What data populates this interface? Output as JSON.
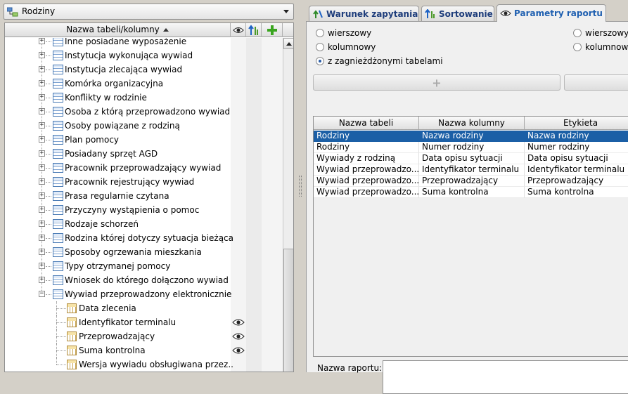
{
  "combo": {
    "value": "Rodziny"
  },
  "tree": {
    "header": {
      "name": "Nazwa tabeli/kolumny"
    },
    "items": [
      {
        "label": "Inne posiadane wyposażenie",
        "type": "table",
        "expanded": false,
        "visible": false
      },
      {
        "label": "Instytucja wykonująca wywiad",
        "type": "table",
        "expanded": false,
        "visible": false
      },
      {
        "label": "Instytucja zlecająca wywiad",
        "type": "table",
        "expanded": false,
        "visible": false
      },
      {
        "label": "Komórka organizacyjna",
        "type": "table",
        "expanded": false,
        "visible": false
      },
      {
        "label": "Konflikty w rodzinie",
        "type": "table",
        "expanded": false,
        "visible": false
      },
      {
        "label": "Osoba z którą przeprowadzono wywiad",
        "type": "table",
        "expanded": false,
        "visible": false
      },
      {
        "label": "Osoby powiązane z rodziną",
        "type": "table",
        "expanded": false,
        "visible": false
      },
      {
        "label": "Plan pomocy",
        "type": "table",
        "expanded": false,
        "visible": false
      },
      {
        "label": "Posiadany sprzęt AGD",
        "type": "table",
        "expanded": false,
        "visible": false
      },
      {
        "label": "Pracownik przeprowadzający wywiad",
        "type": "table",
        "expanded": false,
        "visible": false
      },
      {
        "label": "Pracownik rejestrujący wywiad",
        "type": "table",
        "expanded": false,
        "visible": false
      },
      {
        "label": "Prasa regularnie czytana",
        "type": "table",
        "expanded": false,
        "visible": false
      },
      {
        "label": "Przyczyny wystąpienia o pomoc",
        "type": "table",
        "expanded": false,
        "visible": false
      },
      {
        "label": "Rodzaje schorzeń",
        "type": "table",
        "expanded": false,
        "visible": false
      },
      {
        "label": "Rodzina której dotyczy sytuacja bieżąca",
        "type": "table",
        "expanded": false,
        "visible": false
      },
      {
        "label": "Sposoby ogrzewania mieszkania",
        "type": "table",
        "expanded": false,
        "visible": false
      },
      {
        "label": "Typy otrzymanej pomocy",
        "type": "table",
        "expanded": false,
        "visible": false
      },
      {
        "label": "Wniosek do którego dołączono wywiad",
        "type": "table",
        "expanded": false,
        "visible": false
      },
      {
        "label": "Wywiad przeprowadzony elektronicznie",
        "type": "table",
        "expanded": true,
        "visible": false
      },
      {
        "label": "Data zlecenia",
        "type": "field",
        "visible": false
      },
      {
        "label": "Identyfikator terminalu",
        "type": "field",
        "visible": true
      },
      {
        "label": "Przeprowadzający",
        "type": "field",
        "visible": true
      },
      {
        "label": "Suma kontrolna",
        "type": "field",
        "visible": true
      },
      {
        "label": "Wersja wywiadu obsługiwana przez..",
        "type": "field",
        "visible": false
      }
    ]
  },
  "tabs": [
    {
      "label": "Warunek zapytania",
      "icon": "filter-icon",
      "active": false
    },
    {
      "label": "Sortowanie",
      "icon": "sort-icon",
      "active": false
    },
    {
      "label": "Parametry raportu",
      "icon": "eye-icon",
      "active": true
    }
  ],
  "layout_options": {
    "left": [
      {
        "label": "wierszowy",
        "checked": false
      },
      {
        "label": "kolumnowy",
        "checked": false
      },
      {
        "label": "z zagnieżdżonymi tabelami",
        "checked": true
      }
    ],
    "right": [
      {
        "label": "wierszowy",
        "checked": false
      },
      {
        "label": "kolumnowy",
        "checked": false
      }
    ]
  },
  "buttons": {
    "add": "+"
  },
  "grid": {
    "columns": [
      "Nazwa tabeli",
      "Nazwa kolumny",
      "Etykieta"
    ],
    "rows": [
      [
        "Rodziny",
        "Nazwa rodziny",
        "Nazwa rodziny"
      ],
      [
        "Rodziny",
        "Numer rodziny",
        "Numer rodziny"
      ],
      [
        "Wywiady z rodziną",
        "Data opisu sytuacji",
        "Data opisu sytuacji"
      ],
      [
        "Wywiad przeprowadzo...",
        "Identyfikator terminalu",
        "Identyfikator terminalu"
      ],
      [
        "Wywiad przeprowadzo...",
        "Przeprowadzający",
        "Przeprowadzający"
      ],
      [
        "Wywiad przeprowadzo...",
        "Suma kontrolna",
        "Suma kontrolna"
      ]
    ],
    "selected_row": 0
  },
  "report": {
    "name_label": "Nazwa raportu:",
    "name_value": ""
  }
}
